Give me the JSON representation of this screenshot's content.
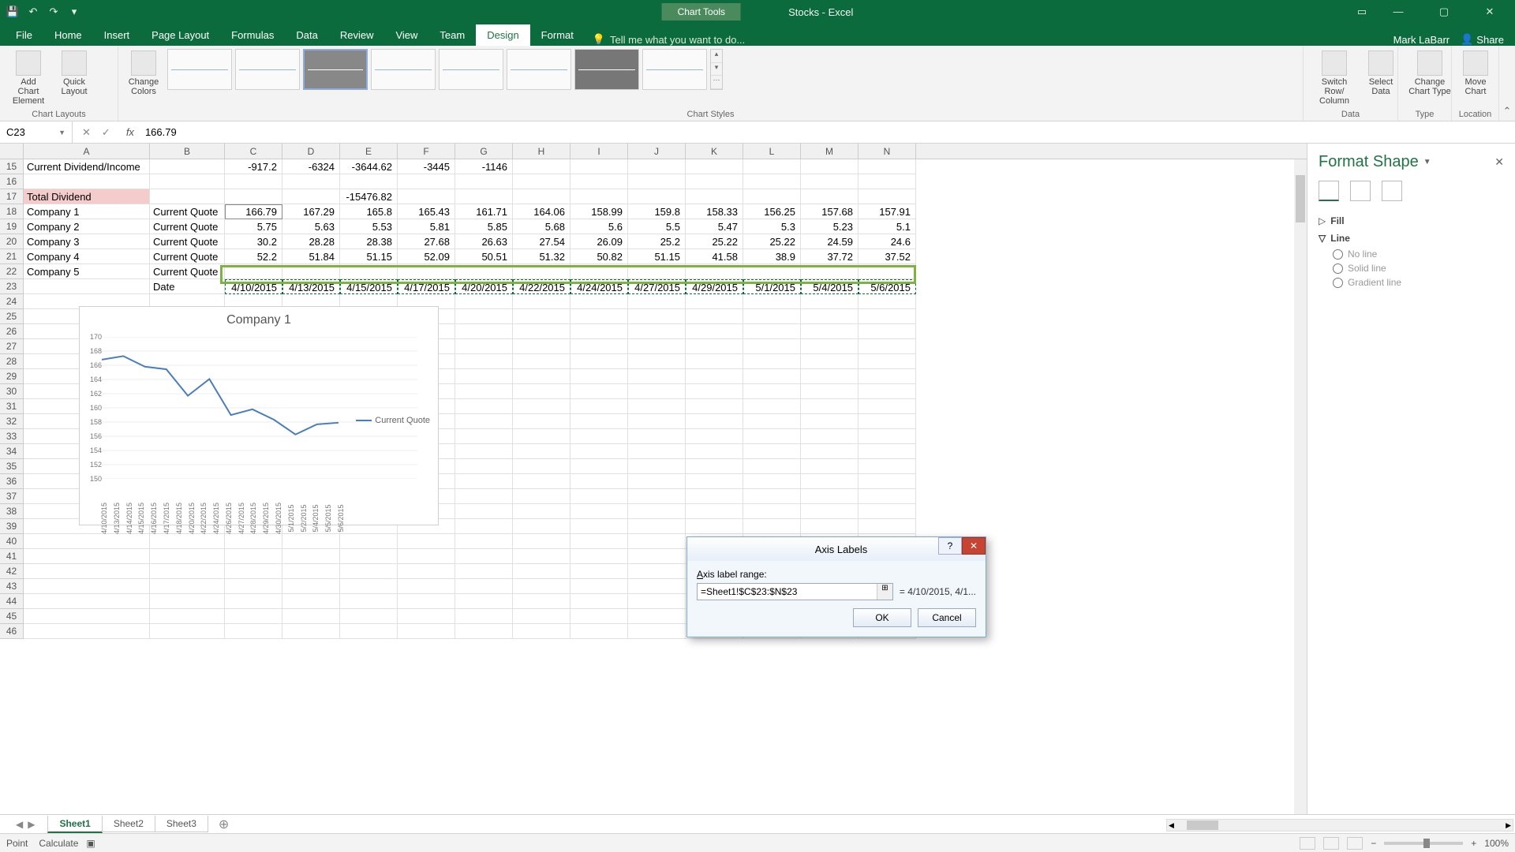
{
  "titlebar": {
    "chart_tools": "Chart Tools",
    "doc": "Stocks - Excel"
  },
  "tabs": {
    "file": "File",
    "home": "Home",
    "insert": "Insert",
    "pagelayout": "Page Layout",
    "formulas": "Formulas",
    "data": "Data",
    "review": "Review",
    "view": "View",
    "team": "Team",
    "design": "Design",
    "format": "Format",
    "tell": "Tell me what you want to do...",
    "user": "Mark LaBarr",
    "share": "Share"
  },
  "ribbon": {
    "add_elem": "Add Chart Element",
    "quick": "Quick Layout",
    "colors": "Change Colors",
    "g_layouts": "Chart Layouts",
    "g_styles": "Chart Styles",
    "g_data": "Data",
    "g_type": "Type",
    "g_loc": "Location",
    "switch": "Switch Row/ Column",
    "select": "Select Data",
    "change_type": "Change Chart Type",
    "move": "Move Chart"
  },
  "fbar": {
    "name": "C23",
    "fx": "fx",
    "formula": "166.79"
  },
  "cols": [
    "A",
    "B",
    "C",
    "D",
    "E",
    "F",
    "G",
    "H",
    "I",
    "J",
    "K",
    "L",
    "M",
    "N"
  ],
  "rows_hdr": [
    15,
    16,
    17,
    18,
    19,
    20,
    21,
    22,
    23,
    24,
    25,
    26,
    27,
    28,
    29,
    30,
    31,
    32,
    33,
    34,
    35,
    36,
    37,
    38,
    39,
    40,
    41,
    42,
    43,
    44,
    45,
    46
  ],
  "grid": {
    "r15": {
      "A": "Current Dividend/Income",
      "C": "-917.2",
      "D": "-6324",
      "E": "-3644.62",
      "F": "-3445",
      "G": "-1146"
    },
    "r17": {
      "A": "Total Dividend",
      "E": "-15476.82"
    },
    "r18": {
      "A": "Company 1",
      "B": "Current Quote",
      "C": "166.79",
      "D": "167.29",
      "E": "165.8",
      "F": "165.43",
      "G": "161.71",
      "H": "164.06",
      "I": "158.99",
      "J": "159.8",
      "K": "158.33",
      "L": "156.25",
      "M": "157.68",
      "N": "157.91"
    },
    "r19": {
      "A": "Company 2",
      "B": "Current Quote",
      "C": "5.75",
      "D": "5.63",
      "E": "5.53",
      "F": "5.81",
      "G": "5.85",
      "H": "5.68",
      "I": "5.6",
      "J": "5.5",
      "K": "5.47",
      "L": "5.3",
      "M": "5.23",
      "N": "5.1"
    },
    "r20": {
      "A": "Company 3",
      "B": "Current Quote",
      "C": "30.2",
      "D": "28.28",
      "E": "28.38",
      "F": "27.68",
      "G": "26.63",
      "H": "27.54",
      "I": "26.09",
      "J": "25.2",
      "K": "25.22",
      "L": "25.22",
      "M": "24.59",
      "N": "24.6"
    },
    "r21": {
      "A": "Company 4",
      "B": "Current Quote",
      "C": "52.2",
      "D": "51.84",
      "E": "51.15",
      "F": "52.09",
      "G": "50.51",
      "H": "51.32",
      "I": "50.82",
      "J": "51.15",
      "K": "41.58",
      "L": "38.9",
      "M": "37.72",
      "N": "37.52"
    },
    "r22": {
      "A": "Company 5",
      "B": "Current Quote"
    },
    "r23": {
      "B": "Date",
      "C": "4/10/2015",
      "D": "4/13/2015",
      "E": "4/15/2015",
      "F": "4/17/2015",
      "G": "4/20/2015",
      "H": "4/22/2015",
      "I": "4/24/2015",
      "J": "4/27/2015",
      "K": "4/29/2015",
      "L": "5/1/2015",
      "M": "5/4/2015",
      "N": "5/6/2015"
    }
  },
  "chart_data": {
    "type": "line",
    "title": "Company 1",
    "series": [
      {
        "name": "Current Quote",
        "values": [
          166.79,
          167.29,
          165.8,
          165.43,
          161.71,
          164.06,
          158.99,
          159.8,
          158.33,
          156.25,
          157.68,
          157.91
        ]
      }
    ],
    "categories": [
      "4/10/2015",
      "4/13/2015",
      "4/14/2015",
      "4/15/2015",
      "4/16/2015",
      "4/17/2015",
      "4/18/2015",
      "4/20/2015",
      "4/22/2015",
      "4/24/2015",
      "4/26/2015",
      "4/27/2015",
      "4/28/2015",
      "4/29/2015",
      "4/30/2015",
      "5/1/2015",
      "5/2/2015",
      "5/4/2015",
      "5/5/2015",
      "5/6/2015"
    ],
    "y_ticks": [
      150,
      152,
      154,
      156,
      158,
      160,
      162,
      164,
      166,
      168,
      170
    ],
    "ylim": [
      150,
      170
    ]
  },
  "dialog": {
    "title": "Axis Labels",
    "label": "Axis label range:",
    "value": "=Sheet1!$C$23:$N$23",
    "preview": "= 4/10/2015, 4/1...",
    "ok": "OK",
    "cancel": "Cancel"
  },
  "format_pane": {
    "title": "Format Shape",
    "fill": "Fill",
    "line": "Line",
    "noline": "No line",
    "solid": "Solid line",
    "grad": "Gradient line"
  },
  "sheets": {
    "s1": "Sheet1",
    "s2": "Sheet2",
    "s3": "Sheet3"
  },
  "status": {
    "mode": "Point",
    "calc": "Calculate",
    "zoom": "100%"
  }
}
